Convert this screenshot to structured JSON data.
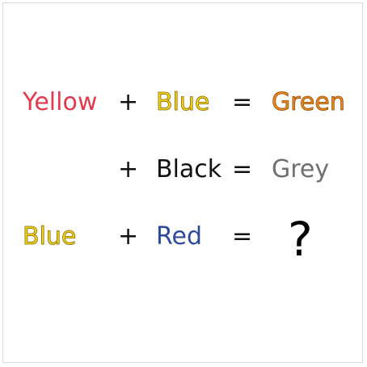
{
  "rows": [
    {
      "left": "Yellow",
      "plus": "+",
      "mid": "Blue",
      "equals": "=",
      "right": "Green"
    },
    {
      "plus": "+",
      "mid": "Black",
      "equals": "=",
      "right": "Grey"
    },
    {
      "left": "Blue",
      "plus": "+",
      "mid": "Red",
      "equals": "=",
      "right": "?"
    }
  ],
  "colors": {
    "yellow_word": "#e03a4e",
    "blue_word_fill": "#f2d51b",
    "green_word_fill": "#e88a22",
    "black_word": "#111111",
    "grey_word": "#6f6f6f",
    "red_word": "#2f4a9a"
  }
}
